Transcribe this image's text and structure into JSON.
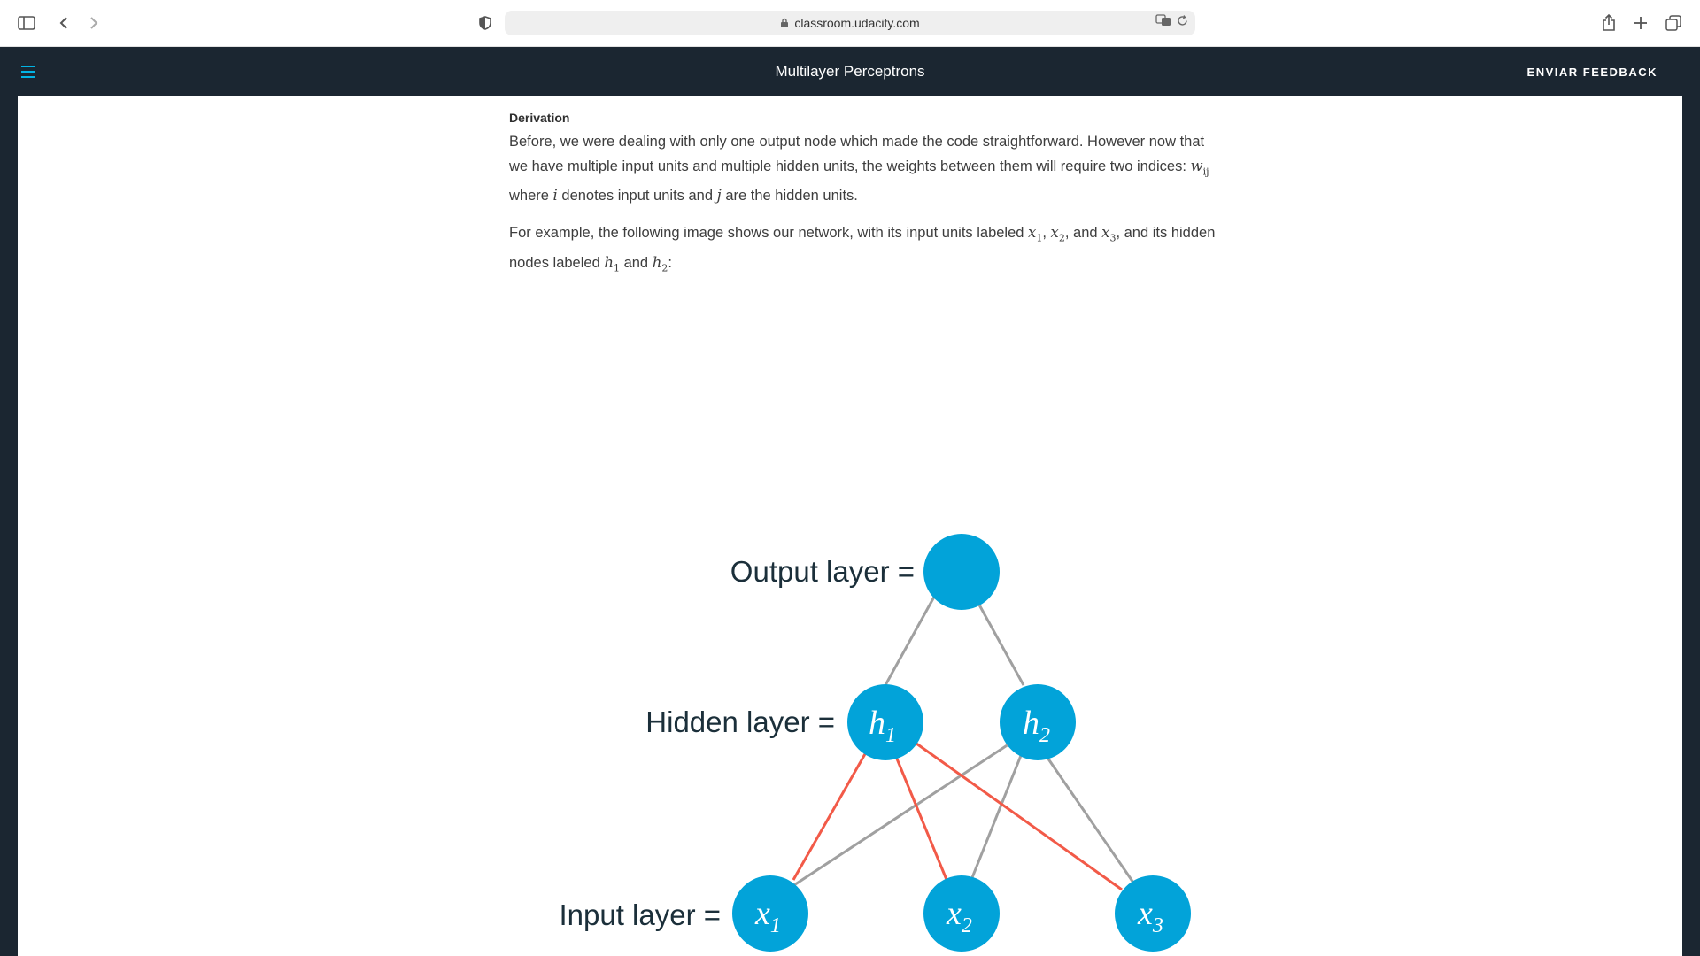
{
  "browser": {
    "url": "classroom.udacity.com",
    "icons": [
      "sidebar-icon",
      "back-icon",
      "forward-icon",
      "shield-icon",
      "lock-icon",
      "translate-icon",
      "reload-icon",
      "share-icon",
      "new-tab-icon",
      "tabs-icon"
    ]
  },
  "header": {
    "title": "Multilayer Perceptrons",
    "feedback_label": "ENVIAR FEEDBACK",
    "menu_icon": "hamburger-menu-icon"
  },
  "article": {
    "heading": "Derivation",
    "p1_a": "Before, we were dealing with only one output node which made the code straightforward. However now that we have multiple input units and multiple hidden units, the weights between them will require two indices: ",
    "p1_w": "w",
    "p1_w_sub": "ij",
    "p1_b": " where ",
    "p1_i": "i",
    "p1_c": " denotes input units and ",
    "p1_j": "j",
    "p1_d": " are the hidden units.",
    "p2_a": "For example, the following image shows our network, with its input units labeled ",
    "p2_x1": "x",
    "p2_x1_sub": "1",
    "p2_x2": "x",
    "p2_x2_sub": "2",
    "p2_and1": ", and ",
    "p2_x3": "x",
    "p2_x3_sub": "3",
    "p2_b": ", and its hidden nodes labeled ",
    "p2_h1": "h",
    "p2_h1_sub": "1",
    "p2_and2": " and ",
    "p2_h2": "h",
    "p2_h2_sub": "2",
    "p2_end": ":"
  },
  "diagram": {
    "output_label": "Output layer =",
    "hidden_label": "Hidden layer =",
    "input_label": "Input layer =",
    "nodes": {
      "h1": {
        "letter": "h",
        "sub": "1"
      },
      "h2": {
        "letter": "h",
        "sub": "2"
      },
      "x1": {
        "letter": "x",
        "sub": "1"
      },
      "x2": {
        "letter": "x",
        "sub": "2"
      },
      "x3": {
        "letter": "x",
        "sub": "3"
      }
    },
    "colors": {
      "node": "#02a3d9",
      "edge": "#a0a0a0",
      "highlight_edge": "#f25a48",
      "label": "#1b2f3a"
    }
  }
}
